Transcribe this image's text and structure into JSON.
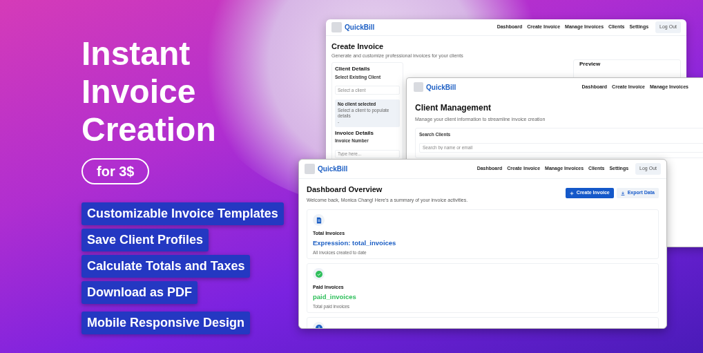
{
  "hero": {
    "headline": [
      "Instant",
      "Invoice",
      "Creation"
    ],
    "price": "for 3$",
    "features": [
      "Customizable Invoice Templates",
      "Save Client Profiles",
      "Calculate Totals and Taxes",
      "Download as PDF",
      "Mobile Responsive Design"
    ]
  },
  "create_invoice_window": {
    "brand": "QuickBill",
    "nav": [
      "Dashboard",
      "Create Invoice",
      "Manage Invoices",
      "Clients",
      "Settings"
    ],
    "logout": "Log Out",
    "title": "Create Invoice",
    "subtitle": "Generate and customize professional invoices for your clients",
    "client_details": {
      "heading": "Client Details",
      "label": "Select Existing Client",
      "placeholder": "Select a client",
      "notice_title": "No client selected",
      "notice_text": "Select a client to populate details",
      "notice_value": "-"
    },
    "invoice_details": {
      "heading": "Invoice Details",
      "label": "Invoice Number",
      "placeholder": "Type here..."
    },
    "preview": {
      "heading": "Preview"
    }
  },
  "client_window": {
    "brand": "QuickBill",
    "nav": [
      "Dashboard",
      "Create Invoice",
      "Manage Invoices"
    ],
    "title": "Client Management",
    "subtitle": "Manage your client information to streamline invoice creation",
    "search_label": "Search Clients",
    "search_placeholder": "Search by name or email"
  },
  "dashboard_window": {
    "brand": "QuickBill",
    "nav": [
      "Dashboard",
      "Create Invoice",
      "Manage Invoices",
      "Clients",
      "Settings"
    ],
    "logout": "Log Out",
    "title": "Dashboard Overview",
    "subtitle": "Welcome back, Monica Chang! Here's a summary of your invoice activities.",
    "actions": [
      {
        "kind": "primary",
        "label": "Create Invoice"
      },
      {
        "kind": "secondary",
        "label": "Export Data"
      }
    ],
    "stats": [
      {
        "kind": "total",
        "label": "Total Invoices",
        "value": "Expression: total_invoices",
        "note": "All invoices created to date",
        "color": "#1d5fc4"
      },
      {
        "kind": "paid",
        "label": "Paid Invoices",
        "value": "paid_invoices",
        "note": "Total paid invoices",
        "color": "#2fbf5b"
      },
      {
        "kind": "pending",
        "color": "#1d5fc4"
      }
    ]
  }
}
